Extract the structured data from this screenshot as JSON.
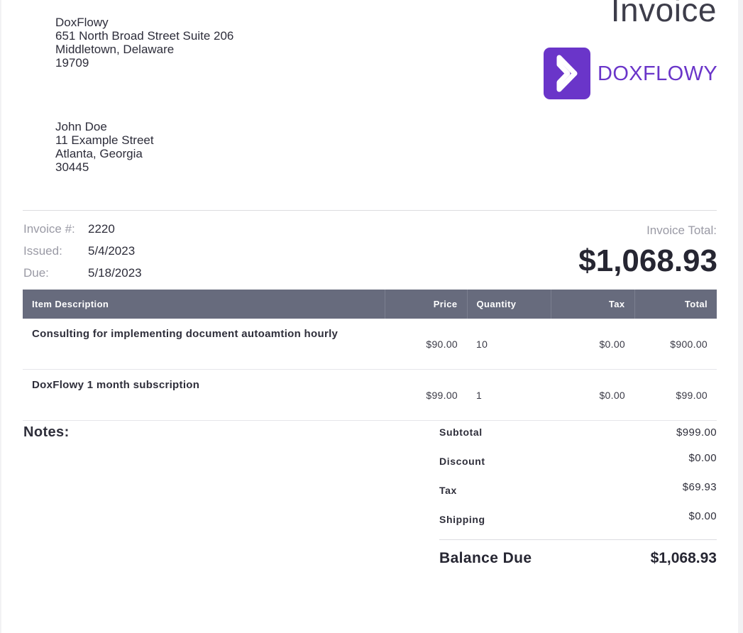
{
  "document": {
    "title": "Invoice",
    "logo_text": "DOXFLOWY",
    "brand_color": "#6a35c9",
    "header_color": "#676b7d"
  },
  "sender": {
    "name": "DoxFlowy",
    "address_line1": "651 North Broad Street Suite 206",
    "city_state": "Middletown, Delaware",
    "zip": "19709"
  },
  "recipient": {
    "name": "John Doe",
    "address_line1": "11 Example Street",
    "city_state": "Atlanta, Georgia",
    "zip": "30445"
  },
  "meta": {
    "invoice_label": "Invoice #:",
    "invoice_number": "2220",
    "issued_label": "Issued:",
    "issued_date": "5/4/2023",
    "due_label": "Due:",
    "due_date": "5/18/2023"
  },
  "invoice_total": {
    "label": "Invoice Total:",
    "amount": "$1,068.93"
  },
  "table": {
    "headers": [
      "Item Description",
      "Price",
      "Quantity",
      "Tax",
      "Total"
    ],
    "rows": [
      {
        "description": "Consulting for implementing document autoamtion hourly",
        "price": "$90.00",
        "quantity": "10",
        "tax": "$0.00",
        "total": "$900.00"
      },
      {
        "description": "DoxFlowy 1 month subscription",
        "price": "$99.00",
        "quantity": "1",
        "tax": "$0.00",
        "total": "$99.00"
      }
    ]
  },
  "notes": {
    "label": "Notes:"
  },
  "summary": {
    "subtotal_label": "Subtotal",
    "subtotal": "$999.00",
    "discount_label": "Discount",
    "discount": "$0.00",
    "tax_label": "Tax",
    "tax": "$69.93",
    "shipping_label": "Shipping",
    "shipping": "$0.00",
    "balance_label": "Balance Due",
    "balance": "$1,068.93"
  }
}
